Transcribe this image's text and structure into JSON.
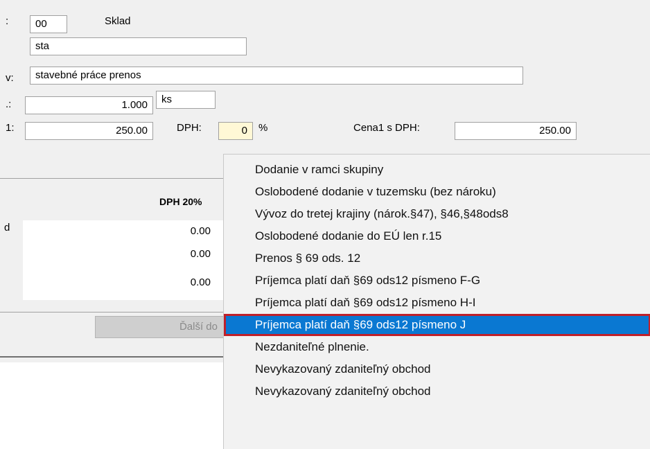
{
  "form": {
    "row1": {
      "left_label": ":",
      "code_value": "00",
      "sklad_label": "Sklad"
    },
    "row2": {
      "value": "sta"
    },
    "row3": {
      "left_label": "v:",
      "value": "stavebné práce prenos"
    },
    "row4": {
      "left_label": ".:",
      "qty_value": "1.000",
      "unit_value": "ks"
    },
    "row5": {
      "left_label": "1:",
      "price_value": "250.00",
      "dph_label": "DPH:",
      "dph_value": "0",
      "percent_label": "%",
      "cena_dph_label": "Cena1 s DPH:",
      "cena_dph_value": "250.00"
    }
  },
  "summary": {
    "header": "DPH 20%",
    "row_label_fragment": "d",
    "values": [
      "0.00",
      "0.00",
      "0.00"
    ]
  },
  "button": {
    "label": "Ďalší do"
  },
  "context_menu": {
    "items": [
      "Dodanie v ramci skupiny",
      "Oslobodené dodanie v tuzemsku (bez nároku)",
      "Vývoz do tretej krajiny (nárok.§47), §46,§48ods8",
      "Oslobodené dodanie do EÚ len r.15",
      "Prenos § 69 ods. 12",
      "Príjemca platí daň §69 ods12 písmeno F-G",
      "Príjemca platí daň §69 ods12 písmeno H-I",
      "Príjemca platí daň §69 ods12 písmeno J",
      "Nezdaniteľné plnenie.",
      "Nevykazovaný zdaniteľný obchod",
      "Nevykazovaný zdaniteľný obchod"
    ],
    "selected_index": 7,
    "colors": {
      "selected_bg": "#0a78d2",
      "selected_outline": "#c0202a",
      "menu_bg": "#f2f2f2"
    }
  }
}
